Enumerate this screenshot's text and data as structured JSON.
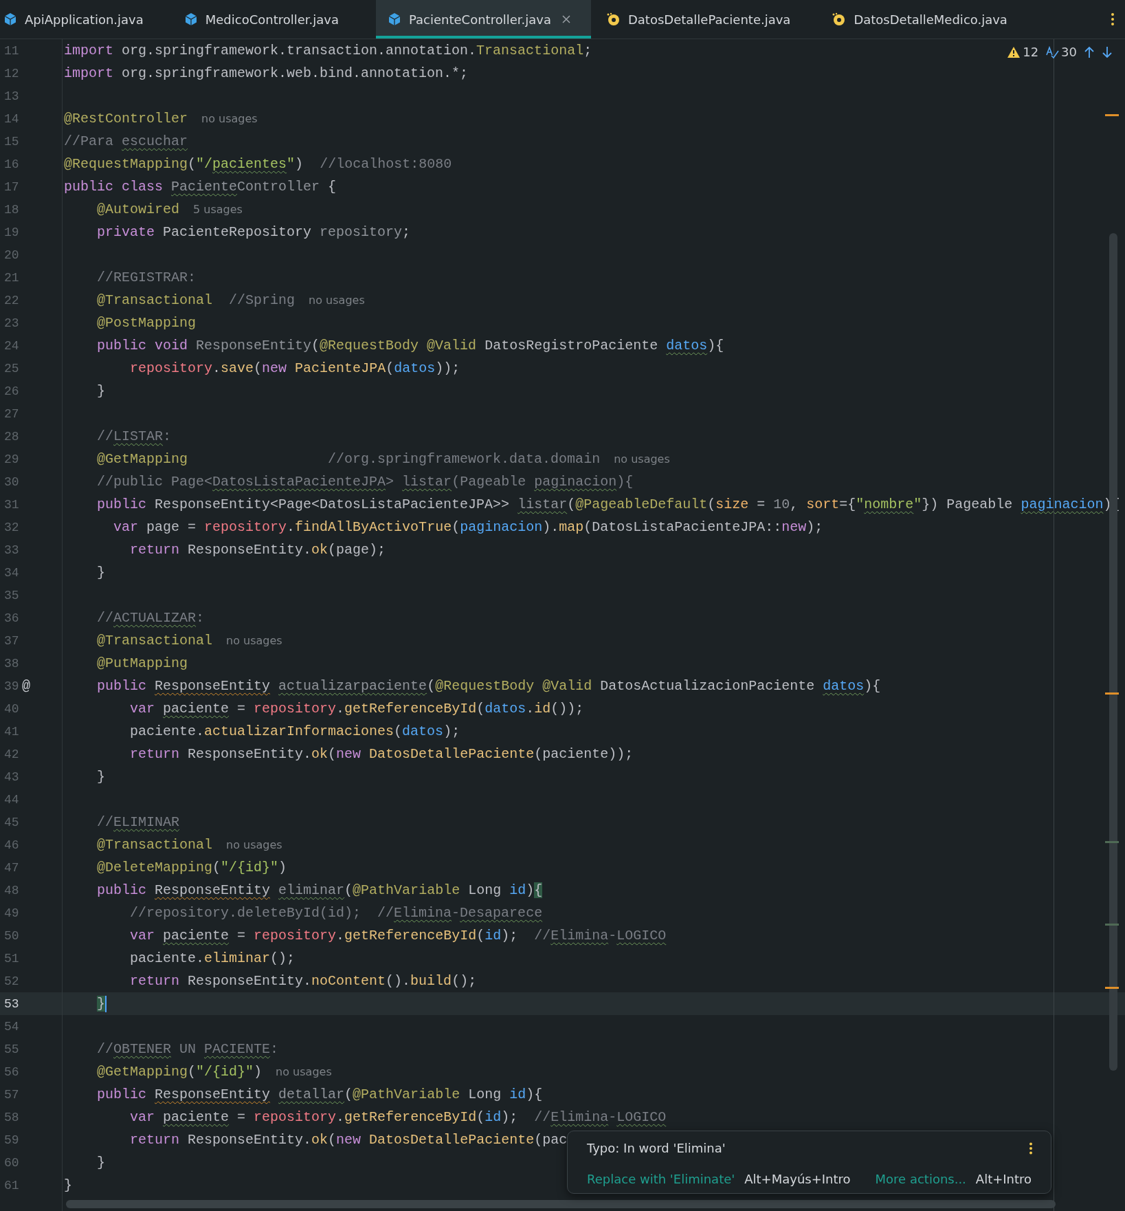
{
  "tabs": [
    {
      "label": "ApiApplication.java",
      "kind": "class",
      "selected": false
    },
    {
      "label": "MedicoController.java",
      "kind": "class",
      "selected": false
    },
    {
      "label": "PacienteController.java",
      "kind": "class",
      "selected": true
    },
    {
      "label": "DatosDetallePaciente.java",
      "kind": "record",
      "selected": false
    },
    {
      "label": "DatosDetalleMedico.java",
      "kind": "record",
      "selected": false
    }
  ],
  "inspections": {
    "warnings": "12",
    "typos": "30"
  },
  "lines": [
    {
      "number": "11",
      "current": false,
      "tokens": [
        {
          "text": "import",
          "kind": "keyword"
        },
        {
          "text": " org.springframework.transaction.annotation.",
          "kind": "plain"
        },
        {
          "text": "Transactional",
          "kind": "annotation"
        },
        {
          "text": ";",
          "kind": "plain"
        }
      ]
    },
    {
      "number": "12",
      "current": false,
      "tokens": [
        {
          "text": "import",
          "kind": "keyword"
        },
        {
          "text": " org.springframework.web.bind.annotation.*;",
          "kind": "plain"
        }
      ]
    },
    {
      "number": "13",
      "current": false
    },
    {
      "number": "14",
      "current": false,
      "tokens": [
        {
          "text": "@RestController",
          "kind": "annotation"
        }
      ],
      "hint": "no usages"
    },
    {
      "number": "15",
      "current": false,
      "tokens": [
        {
          "text": "//Para ",
          "kind": "comment"
        },
        {
          "text": "escuchar",
          "kind": "comment",
          "misspelled": true
        }
      ]
    },
    {
      "number": "16",
      "current": false,
      "tokens": [
        {
          "text": "@RequestMapping",
          "kind": "annotation"
        },
        {
          "text": "(",
          "kind": "plain"
        },
        {
          "text": "\"/",
          "kind": "string"
        },
        {
          "text": "pacientes",
          "kind": "string",
          "misspelled": true
        },
        {
          "text": "\"",
          "kind": "string"
        },
        {
          "text": ")  ",
          "kind": "plain"
        },
        {
          "text": "//localhost:8080",
          "kind": "comment"
        }
      ]
    },
    {
      "number": "17",
      "current": false,
      "tokens": [
        {
          "text": "public class ",
          "kind": "keyword"
        },
        {
          "text": "Paciente",
          "kind": "unused",
          "misspelled": true
        },
        {
          "text": "Controller",
          "kind": "unused"
        },
        {
          "text": " {",
          "kind": "plain"
        }
      ]
    },
    {
      "number": "18",
      "current": false,
      "tokens": [
        {
          "text": "    @Autowired",
          "kind": "annotation"
        }
      ],
      "hint": "5 usages"
    },
    {
      "number": "19",
      "current": false,
      "tokens": [
        {
          "text": "    private ",
          "kind": "keyword"
        },
        {
          "text": "PacienteRepository ",
          "kind": "plain"
        },
        {
          "text": "repository",
          "kind": "unused"
        },
        {
          "text": ";",
          "kind": "plain"
        }
      ]
    },
    {
      "number": "20",
      "current": false
    },
    {
      "number": "21",
      "current": false,
      "tokens": [
        {
          "text": "    //REGISTRAR:",
          "kind": "comment"
        }
      ]
    },
    {
      "number": "22",
      "current": false,
      "tokens": [
        {
          "text": "    @Transactional",
          "kind": "annotation"
        },
        {
          "text": "  //Spring",
          "kind": "comment"
        }
      ],
      "hint": "no usages"
    },
    {
      "number": "23",
      "current": false,
      "tokens": [
        {
          "text": "    @PostMapping",
          "kind": "annotation"
        }
      ]
    },
    {
      "number": "24",
      "current": false,
      "tokens": [
        {
          "text": "    public void ",
          "kind": "keyword"
        },
        {
          "text": "ResponseEntity",
          "kind": "unused"
        },
        {
          "text": "(",
          "kind": "plain"
        },
        {
          "text": "@RequestBody @Valid",
          "kind": "annotation"
        },
        {
          "text": " DatosRegistroPaciente ",
          "kind": "plain"
        },
        {
          "text": "datos",
          "kind": "param",
          "misspelled": true
        },
        {
          "text": "){",
          "kind": "plain"
        }
      ]
    },
    {
      "number": "25",
      "current": false,
      "tokens": [
        {
          "text": "        repository",
          "kind": "field"
        },
        {
          "text": ".",
          "kind": "plain"
        },
        {
          "text": "save",
          "kind": "method"
        },
        {
          "text": "(",
          "kind": "plain"
        },
        {
          "text": "new ",
          "kind": "keyword"
        },
        {
          "text": "PacienteJPA",
          "kind": "method"
        },
        {
          "text": "(",
          "kind": "plain"
        },
        {
          "text": "datos",
          "kind": "param"
        },
        {
          "text": "));",
          "kind": "plain"
        }
      ]
    },
    {
      "number": "26",
      "current": false,
      "tokens": [
        {
          "text": "    }",
          "kind": "plain"
        }
      ]
    },
    {
      "number": "27",
      "current": false
    },
    {
      "number": "28",
      "current": false,
      "tokens": [
        {
          "text": "    //",
          "kind": "comment"
        },
        {
          "text": "LISTAR",
          "kind": "comment",
          "misspelled": true
        },
        {
          "text": ":",
          "kind": "comment"
        }
      ]
    },
    {
      "number": "29",
      "current": false,
      "tokens": [
        {
          "text": "    @GetMapping",
          "kind": "annotation"
        },
        {
          "text": "                 //org.springframework.data.domain",
          "kind": "comment"
        }
      ],
      "hint": "no usages"
    },
    {
      "number": "30",
      "current": false,
      "tokens": [
        {
          "text": "    //public Page<",
          "kind": "comment"
        },
        {
          "text": "DatosListaPacienteJPA",
          "kind": "comment",
          "misspelled": true
        },
        {
          "text": "> ",
          "kind": "comment"
        },
        {
          "text": "listar",
          "kind": "comment",
          "misspelled": true
        },
        {
          "text": "(Pageable ",
          "kind": "comment"
        },
        {
          "text": "paginacion",
          "kind": "comment",
          "misspelled": true
        },
        {
          "text": "){",
          "kind": "comment"
        }
      ]
    },
    {
      "number": "31",
      "current": false,
      "tokens": [
        {
          "text": "    public ",
          "kind": "keyword"
        },
        {
          "text": "ResponseEntity<Page<DatosListaPacienteJPA>> ",
          "kind": "plain"
        },
        {
          "text": "listar",
          "kind": "unused",
          "misspelled": true
        },
        {
          "text": "(",
          "kind": "plain"
        },
        {
          "text": "@PageableDefault",
          "kind": "annotation"
        },
        {
          "text": "(",
          "kind": "plain"
        },
        {
          "text": "size",
          "kind": "attribute"
        },
        {
          "text": " = ",
          "kind": "plain"
        },
        {
          "text": "10",
          "kind": "number"
        },
        {
          "text": ", ",
          "kind": "plain"
        },
        {
          "text": "sort",
          "kind": "attribute"
        },
        {
          "text": "={",
          "kind": "plain"
        },
        {
          "text": "\"",
          "kind": "string"
        },
        {
          "text": "nombre",
          "kind": "string",
          "misspelled": true
        },
        {
          "text": "\"",
          "kind": "string"
        },
        {
          "text": "}) Pageable ",
          "kind": "plain"
        },
        {
          "text": "paginacion",
          "kind": "param",
          "misspelled": true
        },
        {
          "text": "){",
          "kind": "plain"
        }
      ]
    },
    {
      "number": "32",
      "current": false,
      "tokens": [
        {
          "text": "      var ",
          "kind": "keyword"
        },
        {
          "text": "page = ",
          "kind": "plain"
        },
        {
          "text": "repository",
          "kind": "field"
        },
        {
          "text": ".",
          "kind": "plain"
        },
        {
          "text": "findAllByActivoTrue",
          "kind": "method"
        },
        {
          "text": "(",
          "kind": "plain"
        },
        {
          "text": "paginacion",
          "kind": "param"
        },
        {
          "text": ").",
          "kind": "plain"
        },
        {
          "text": "map",
          "kind": "method"
        },
        {
          "text": "(DatosListaPacienteJPA::",
          "kind": "plain"
        },
        {
          "text": "new",
          "kind": "keyword"
        },
        {
          "text": ");",
          "kind": "plain"
        }
      ]
    },
    {
      "number": "33",
      "current": false,
      "tokens": [
        {
          "text": "        return ",
          "kind": "keyword"
        },
        {
          "text": "ResponseEntity.",
          "kind": "plain"
        },
        {
          "text": "ok",
          "kind": "method"
        },
        {
          "text": "(page);",
          "kind": "plain"
        }
      ]
    },
    {
      "number": "34",
      "current": false,
      "tokens": [
        {
          "text": "    }",
          "kind": "plain"
        }
      ]
    },
    {
      "number": "35",
      "current": false
    },
    {
      "number": "36",
      "current": false,
      "tokens": [
        {
          "text": "    //",
          "kind": "comment"
        },
        {
          "text": "ACTUALIZAR",
          "kind": "comment",
          "misspelled": true
        },
        {
          "text": ":",
          "kind": "comment"
        }
      ]
    },
    {
      "number": "37",
      "current": false,
      "tokens": [
        {
          "text": "    @Transactional",
          "kind": "annotation"
        }
      ],
      "hint": "no usages"
    },
    {
      "number": "38",
      "current": false,
      "tokens": [
        {
          "text": "    @PutMapping",
          "kind": "annotation"
        }
      ]
    },
    {
      "number": "39",
      "current": false,
      "gutter_mark": "@",
      "tokens": [
        {
          "text": "    public ",
          "kind": "keyword"
        },
        {
          "text": "ResponseEntity ",
          "kind": "plain",
          "warning": true
        },
        {
          "text": "actualizarpaciente",
          "kind": "unused",
          "misspelled": true
        },
        {
          "text": "(",
          "kind": "plain"
        },
        {
          "text": "@RequestBody @Valid",
          "kind": "annotation"
        },
        {
          "text": " DatosActualizacionPaciente ",
          "kind": "plain"
        },
        {
          "text": "datos",
          "kind": "param",
          "misspelled": true
        },
        {
          "text": "){",
          "kind": "plain"
        }
      ]
    },
    {
      "number": "40",
      "current": false,
      "tokens": [
        {
          "text": "        var ",
          "kind": "keyword"
        },
        {
          "text": "paciente",
          "kind": "plain",
          "misspelled": true
        },
        {
          "text": " = ",
          "kind": "plain"
        },
        {
          "text": "repository",
          "kind": "field"
        },
        {
          "text": ".",
          "kind": "plain"
        },
        {
          "text": "getReferenceById",
          "kind": "method"
        },
        {
          "text": "(",
          "kind": "plain"
        },
        {
          "text": "datos",
          "kind": "param"
        },
        {
          "text": ".",
          "kind": "plain"
        },
        {
          "text": "id",
          "kind": "method"
        },
        {
          "text": "());",
          "kind": "plain"
        }
      ]
    },
    {
      "number": "41",
      "current": false,
      "tokens": [
        {
          "text": "        paciente.",
          "kind": "plain"
        },
        {
          "text": "actualizarInformaciones",
          "kind": "method"
        },
        {
          "text": "(",
          "kind": "plain"
        },
        {
          "text": "datos",
          "kind": "param"
        },
        {
          "text": ");",
          "kind": "plain"
        }
      ]
    },
    {
      "number": "42",
      "current": false,
      "tokens": [
        {
          "text": "        return ",
          "kind": "keyword"
        },
        {
          "text": "ResponseEntity.",
          "kind": "plain"
        },
        {
          "text": "ok",
          "kind": "method"
        },
        {
          "text": "(",
          "kind": "plain"
        },
        {
          "text": "new ",
          "kind": "keyword"
        },
        {
          "text": "DatosDetallePaciente",
          "kind": "method"
        },
        {
          "text": "(paciente));",
          "kind": "plain"
        }
      ]
    },
    {
      "number": "43",
      "current": false,
      "tokens": [
        {
          "text": "    }",
          "kind": "plain"
        }
      ]
    },
    {
      "number": "44",
      "current": false
    },
    {
      "number": "45",
      "current": false,
      "tokens": [
        {
          "text": "    //",
          "kind": "comment"
        },
        {
          "text": "ELIMINAR",
          "kind": "comment",
          "misspelled": true
        }
      ]
    },
    {
      "number": "46",
      "current": false,
      "tokens": [
        {
          "text": "    @Transactional",
          "kind": "annotation"
        }
      ],
      "hint": "no usages"
    },
    {
      "number": "47",
      "current": false,
      "tokens": [
        {
          "text": "    @DeleteMapping",
          "kind": "annotation"
        },
        {
          "text": "(",
          "kind": "plain"
        },
        {
          "text": "\"/{id}\"",
          "kind": "string"
        },
        {
          "text": ")",
          "kind": "plain"
        }
      ]
    },
    {
      "number": "48",
      "current": false,
      "tokens": [
        {
          "text": "    public ",
          "kind": "keyword"
        },
        {
          "text": "ResponseEntity ",
          "kind": "plain",
          "warning": true
        },
        {
          "text": "eliminar",
          "kind": "unused",
          "misspelled": true
        },
        {
          "text": "(",
          "kind": "plain"
        },
        {
          "text": "@PathVariable",
          "kind": "annotation"
        },
        {
          "text": " Long ",
          "kind": "plain"
        },
        {
          "text": "id",
          "kind": "param"
        },
        {
          "text": ")",
          "kind": "plain"
        },
        {
          "text": "{",
          "kind": "plain",
          "match": true
        }
      ]
    },
    {
      "number": "49",
      "current": false,
      "tokens": [
        {
          "text": "        //repository.deleteById(id);  //",
          "kind": "comment"
        },
        {
          "text": "Elimina",
          "kind": "comment",
          "misspelled": true
        },
        {
          "text": "-",
          "kind": "comment"
        },
        {
          "text": "Desaparece",
          "kind": "comment",
          "misspelled": true
        }
      ]
    },
    {
      "number": "50",
      "current": false,
      "tokens": [
        {
          "text": "        var ",
          "kind": "keyword"
        },
        {
          "text": "paciente",
          "kind": "plain",
          "misspelled": true
        },
        {
          "text": " = ",
          "kind": "plain"
        },
        {
          "text": "repository",
          "kind": "field"
        },
        {
          "text": ".",
          "kind": "plain"
        },
        {
          "text": "getReferenceById",
          "kind": "method"
        },
        {
          "text": "(",
          "kind": "plain"
        },
        {
          "text": "id",
          "kind": "param"
        },
        {
          "text": ");  ",
          "kind": "plain"
        },
        {
          "text": "//",
          "kind": "comment"
        },
        {
          "text": "Elimina",
          "kind": "comment",
          "misspelled": true
        },
        {
          "text": "-",
          "kind": "comment"
        },
        {
          "text": "LOGICO",
          "kind": "comment",
          "misspelled": true
        }
      ]
    },
    {
      "number": "51",
      "current": false,
      "tokens": [
        {
          "text": "        paciente.",
          "kind": "plain"
        },
        {
          "text": "eliminar",
          "kind": "method"
        },
        {
          "text": "();",
          "kind": "plain"
        }
      ]
    },
    {
      "number": "52",
      "current": false,
      "tokens": [
        {
          "text": "        return ",
          "kind": "keyword"
        },
        {
          "text": "ResponseEntity.",
          "kind": "plain"
        },
        {
          "text": "noContent",
          "kind": "method"
        },
        {
          "text": "().",
          "kind": "plain"
        },
        {
          "text": "build",
          "kind": "method"
        },
        {
          "text": "();",
          "kind": "plain"
        }
      ]
    },
    {
      "number": "53",
      "current": true,
      "tokens": [
        {
          "text": "    }",
          "kind": "plain",
          "match": true
        }
      ]
    },
    {
      "number": "54",
      "current": false
    },
    {
      "number": "55",
      "current": false,
      "tokens": [
        {
          "text": "    //",
          "kind": "comment"
        },
        {
          "text": "OBTENER",
          "kind": "comment",
          "misspelled": true
        },
        {
          "text": " UN ",
          "kind": "comment"
        },
        {
          "text": "PACIENTE",
          "kind": "comment",
          "misspelled": true
        },
        {
          "text": ":",
          "kind": "comment"
        }
      ]
    },
    {
      "number": "56",
      "current": false,
      "tokens": [
        {
          "text": "    @GetMapping",
          "kind": "annotation"
        },
        {
          "text": "(",
          "kind": "plain"
        },
        {
          "text": "\"/{id}\"",
          "kind": "string"
        },
        {
          "text": ")",
          "kind": "plain"
        }
      ],
      "hint": "no usages"
    },
    {
      "number": "57",
      "current": false,
      "tokens": [
        {
          "text": "    public ",
          "kind": "keyword"
        },
        {
          "text": "ResponseEntity ",
          "kind": "plain",
          "warning": true
        },
        {
          "text": "detallar",
          "kind": "unused",
          "misspelled": true
        },
        {
          "text": "(",
          "kind": "plain"
        },
        {
          "text": "@PathVariable",
          "kind": "annotation"
        },
        {
          "text": " Long ",
          "kind": "plain"
        },
        {
          "text": "id",
          "kind": "param"
        },
        {
          "text": "){",
          "kind": "plain"
        }
      ]
    },
    {
      "number": "58",
      "current": false,
      "tokens": [
        {
          "text": "        var ",
          "kind": "keyword"
        },
        {
          "text": "paciente",
          "kind": "plain",
          "misspelled": true
        },
        {
          "text": " = ",
          "kind": "plain"
        },
        {
          "text": "repository",
          "kind": "field"
        },
        {
          "text": ".",
          "kind": "plain"
        },
        {
          "text": "getReferenceById",
          "kind": "method"
        },
        {
          "text": "(",
          "kind": "plain"
        },
        {
          "text": "id",
          "kind": "param"
        },
        {
          "text": ");  ",
          "kind": "plain"
        },
        {
          "text": "//",
          "kind": "comment"
        },
        {
          "text": "Elimina",
          "kind": "comment",
          "misspelled": true
        },
        {
          "text": "-",
          "kind": "comment"
        },
        {
          "text": "LOGICO",
          "kind": "comment",
          "misspelled": true
        }
      ]
    },
    {
      "number": "59",
      "current": false,
      "tokens": [
        {
          "text": "        return ",
          "kind": "keyword"
        },
        {
          "text": "ResponseEntity.",
          "kind": "plain"
        },
        {
          "text": "ok",
          "kind": "method"
        },
        {
          "text": "(",
          "kind": "plain"
        },
        {
          "text": "new ",
          "kind": "keyword"
        },
        {
          "text": "DatosDetallePaciente",
          "kind": "method"
        },
        {
          "text": "(pac",
          "kind": "plain"
        }
      ]
    },
    {
      "number": "60",
      "current": false,
      "tokens": [
        {
          "text": "    }",
          "kind": "plain"
        }
      ]
    },
    {
      "number": "61",
      "current": false,
      "tokens": [
        {
          "text": "}",
          "kind": "plain"
        }
      ]
    }
  ],
  "popup": {
    "title": "Typo: In word 'Elimina'",
    "actions": [
      {
        "label": "Replace with 'Eliminate'",
        "shortcut": "Alt+Mayús+Intro"
      },
      {
        "label": "More actions...",
        "shortcut": "Alt+Intro"
      }
    ]
  }
}
